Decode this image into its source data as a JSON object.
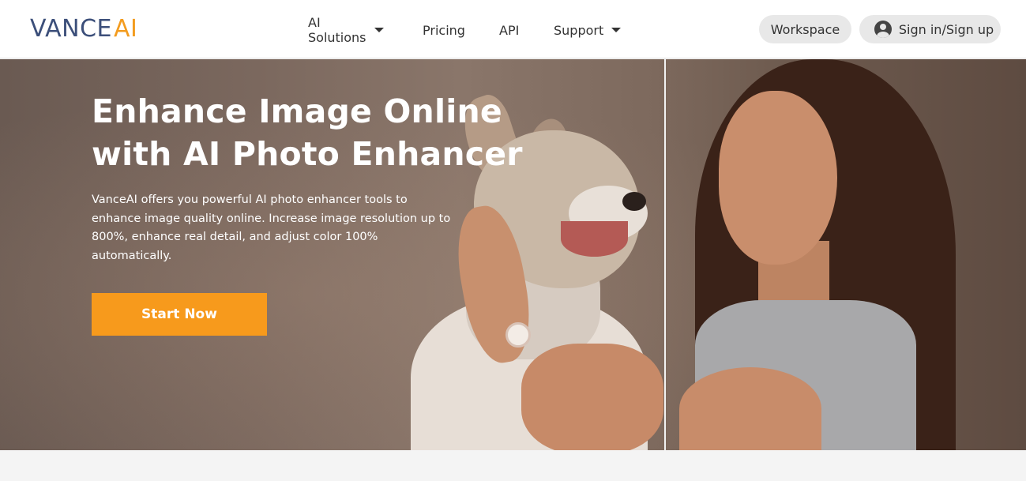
{
  "header": {
    "logo": {
      "part1": "VANCE",
      "part2": "AI"
    },
    "nav": [
      {
        "label": "AI Solutions",
        "has_dropdown": true
      },
      {
        "label": "Pricing",
        "has_dropdown": false
      },
      {
        "label": "API",
        "has_dropdown": false
      },
      {
        "label": "Support",
        "has_dropdown": true
      }
    ],
    "workspace_label": "Workspace",
    "signin_label": "Sign in/Sign up",
    "signin_icon": "user-circle-icon"
  },
  "hero": {
    "title": "Enhance Image Online with AI Photo Enhancer",
    "description": "VanceAI offers you powerful AI photo enhancer tools to enhance image quality online. Increase image resolution up to 800%, enhance real detail, and adjust color 100% automatically.",
    "cta_label": "Start Now"
  },
  "colors": {
    "brand_dark": "#3c4f7a",
    "brand_accent": "#f39c1f",
    "cta": "#f79a1c"
  }
}
